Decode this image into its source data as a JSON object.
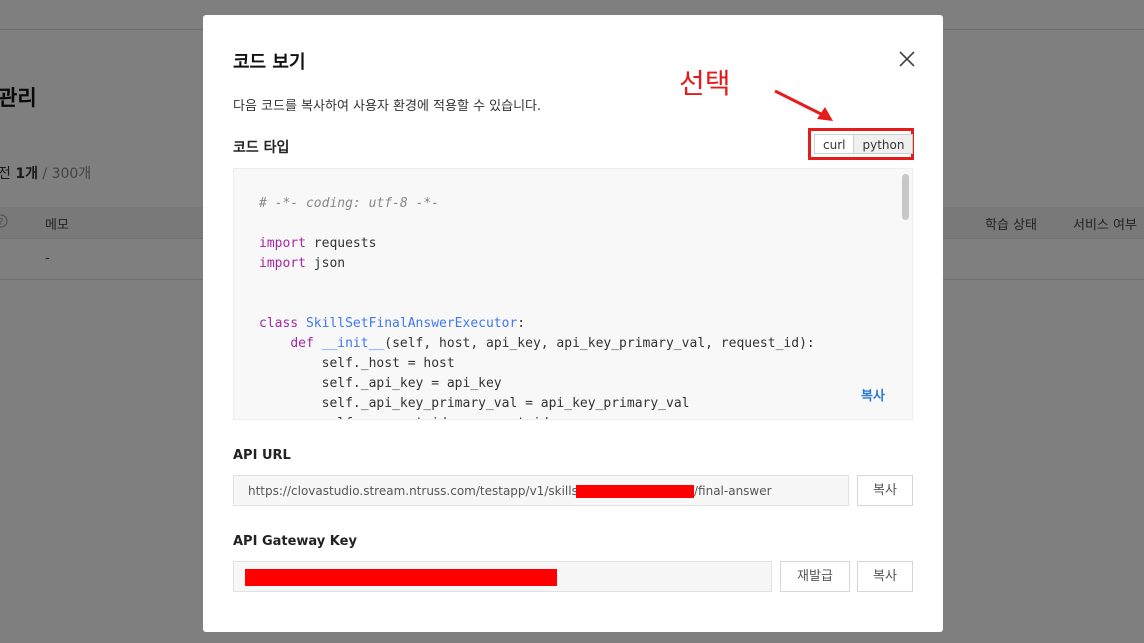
{
  "background": {
    "title": "관리",
    "count_prefix": "전",
    "count_value": "1개",
    "count_max": "/ 300개",
    "columns": [
      "메모",
      "학습 상태",
      "서비스 여부"
    ],
    "row_values": [
      "-"
    ],
    "help_icon": "question-circle-icon"
  },
  "modal": {
    "title": "코드 보기",
    "close_icon": "close-icon",
    "description": "다음 코드를 복사하여 사용자 환경에 적용할 수 있습니다.",
    "code_type_label": "코드 타입",
    "code_types": [
      "curl",
      "python"
    ],
    "selected_code_type": "python",
    "annotation_text": "선택",
    "annotation_color": "#e21a1a",
    "code_lines": [
      {
        "indent": "",
        "parts": [
          {
            "t": "# -*- coding: utf-8 -*-",
            "c": "comment"
          }
        ]
      },
      {
        "indent": "",
        "parts": []
      },
      {
        "indent": "",
        "parts": [
          {
            "t": "import",
            "c": "kw"
          },
          {
            "t": " requests",
            "c": ""
          }
        ]
      },
      {
        "indent": "",
        "parts": [
          {
            "t": "import",
            "c": "kw"
          },
          {
            "t": " json",
            "c": ""
          }
        ]
      },
      {
        "indent": "",
        "parts": []
      },
      {
        "indent": "",
        "parts": []
      },
      {
        "indent": "",
        "parts": [
          {
            "t": "class",
            "c": "kw"
          },
          {
            "t": " ",
            "c": ""
          },
          {
            "t": "SkillSetFinalAnswerExecutor",
            "c": "cls"
          },
          {
            "t": ":",
            "c": ""
          }
        ]
      },
      {
        "indent": "    ",
        "parts": [
          {
            "t": "def",
            "c": "kw"
          },
          {
            "t": " ",
            "c": ""
          },
          {
            "t": "__init__",
            "c": "cls"
          },
          {
            "t": "(self, host, api_key, api_key_primary_val, request_id):",
            "c": ""
          }
        ]
      },
      {
        "indent": "        ",
        "parts": [
          {
            "t": "self._host = host",
            "c": ""
          }
        ]
      },
      {
        "indent": "        ",
        "parts": [
          {
            "t": "self._api_key = api_key",
            "c": ""
          }
        ]
      },
      {
        "indent": "        ",
        "parts": [
          {
            "t": "self._api_key_primary_val = api_key_primary_val",
            "c": ""
          }
        ]
      },
      {
        "indent": "        ",
        "parts": [
          {
            "t": "self._request_id = request_id",
            "c": ""
          }
        ]
      }
    ],
    "code_copy_label": "복사",
    "api_url_label": "API URL",
    "api_url_prefix": "https://clovastudio.stream.ntruss.com/testapp/v1/skillsets",
    "api_url_suffix": "/final-answer",
    "api_url_copy_label": "복사",
    "gateway_key_label": "API Gateway Key",
    "reissue_label": "재발급",
    "gateway_copy_label": "복사",
    "redaction_color": "#ff0000",
    "accent_color": "#2979d6"
  }
}
